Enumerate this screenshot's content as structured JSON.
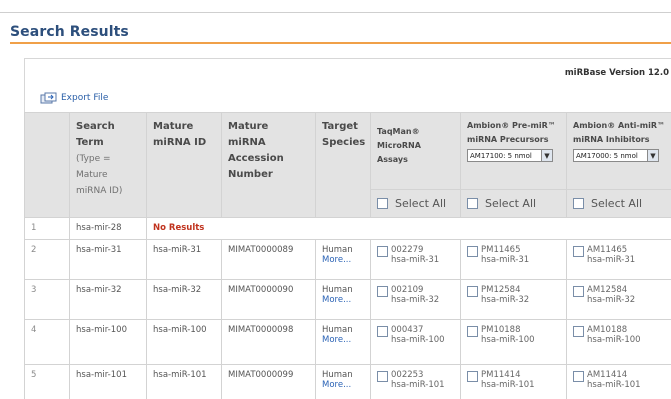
{
  "page": {
    "title": "Search Results"
  },
  "mirbase": "miRBase Version 12.0",
  "export": {
    "label": "Export File"
  },
  "columns": {
    "search_term": "Search Term",
    "search_term_note": "(Type = Mature miRNA ID)",
    "mature_id": "Mature miRNA ID",
    "accession": "Mature miRNA Accession Number",
    "species": "Target Species",
    "taqman": "TaqMan® MicroRNA Assays",
    "premir": "Ambion® Pre-miR™ miRNA Precursors",
    "antimir": "Ambion® Anti-miR™ miRNA Inhibitors"
  },
  "selects": {
    "premir_value": "AM17100: 5 nmol",
    "antimir_value": "AM17000: 5 nmol"
  },
  "select_all_label": "Select All",
  "rows": [
    {
      "n": "1",
      "term": "hsa-mir-28",
      "no_results": "No Results"
    },
    {
      "n": "2",
      "term": "hsa-mir-31",
      "mature": "hsa-miR-31",
      "acc": "MIMAT0000089",
      "species": "Human",
      "more": "More...",
      "taqman_id": "002279",
      "taqman_name": "hsa-miR-31",
      "premir_id": "PM11465",
      "premir_name": "hsa-miR-31",
      "anti_id": "AM11465",
      "anti_name": "hsa-miR-31"
    },
    {
      "n": "3",
      "term": "hsa-mir-32",
      "mature": "hsa-miR-32",
      "acc": "MIMAT0000090",
      "species": "Human",
      "more": "More...",
      "taqman_id": "002109",
      "taqman_name": "hsa-miR-32",
      "premir_id": "PM12584",
      "premir_name": "hsa-miR-32",
      "anti_id": "AM12584",
      "anti_name": "hsa-miR-32"
    },
    {
      "n": "4",
      "term": "hsa-mir-100",
      "mature": "hsa-miR-100",
      "acc": "MIMAT0000098",
      "species": "Human",
      "more": "More...",
      "taqman_id": "000437",
      "taqman_name": "hsa-miR-100",
      "premir_id": "PM10188",
      "premir_name": "hsa-miR-100",
      "anti_id": "AM10188",
      "anti_name": "hsa-miR-100"
    },
    {
      "n": "5",
      "term": "hsa-mir-101",
      "mature": "hsa-miR-101",
      "acc": "MIMAT0000099",
      "species": "Human",
      "more": "More...",
      "taqman_id": "002253",
      "taqman_name": "hsa-miR-101",
      "premir_id": "PM11414",
      "premir_name": "hsa-miR-101",
      "anti_id": "AM11414",
      "anti_name": "hsa-miR-101"
    }
  ],
  "colors": {
    "title": "#2d4f7c",
    "accent_rule": "#f0a048",
    "link": "#2a62b5",
    "no_results": "#c0331e"
  }
}
